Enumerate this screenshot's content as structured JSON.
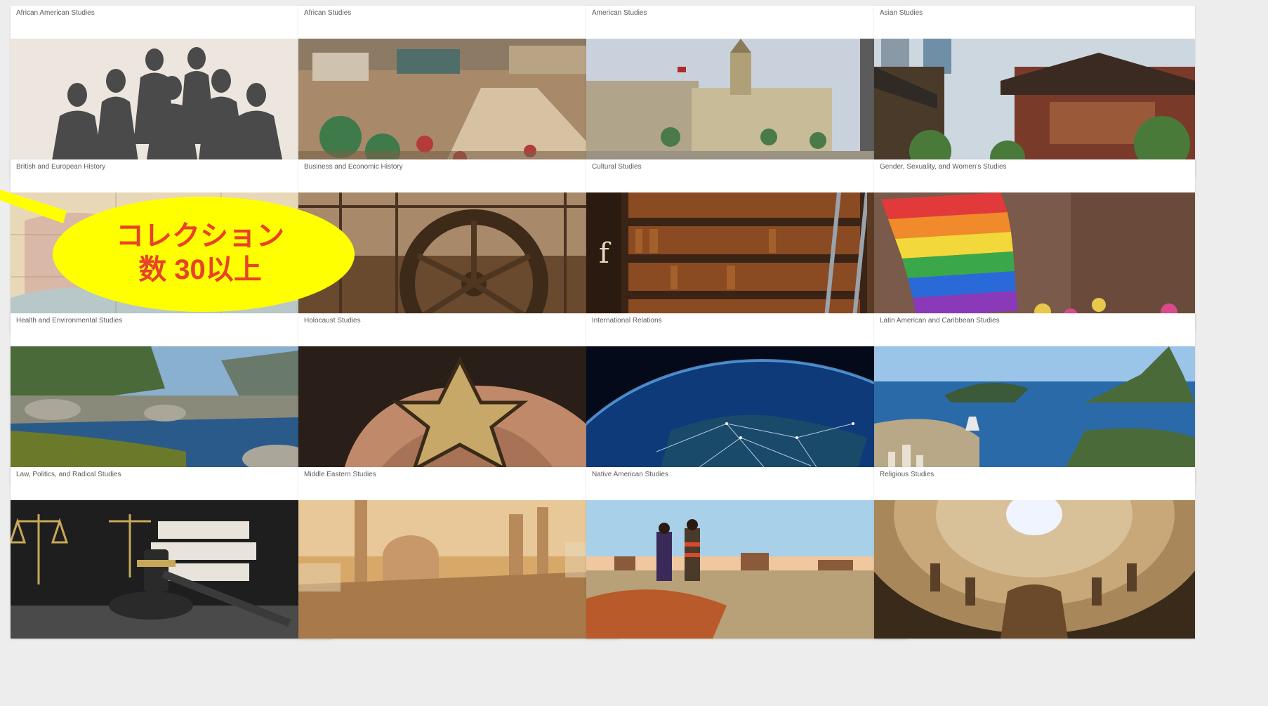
{
  "collections": [
    {
      "title": "African American Studies",
      "image": "portrait-engraving"
    },
    {
      "title": "African Studies",
      "image": "market-street"
    },
    {
      "title": "American Studies",
      "image": "historic-town-square"
    },
    {
      "title": "Asian Studies",
      "image": "chinese-temple-city"
    },
    {
      "title": "British and European History",
      "image": "antique-map"
    },
    {
      "title": "Business and Economic History",
      "image": "industrial-wheel"
    },
    {
      "title": "Cultural Studies",
      "image": "library-bookshelves"
    },
    {
      "title": "Gender, Sexuality, and Women's Studies",
      "image": "rainbow-flag"
    },
    {
      "title": "Health and Environmental Studies",
      "image": "river-landscape"
    },
    {
      "title": "Holocaust Studies",
      "image": "star-badge-hands"
    },
    {
      "title": "International Relations",
      "image": "earth-network"
    },
    {
      "title": "Latin American and Caribbean Studies",
      "image": "rio-bay"
    },
    {
      "title": "Law, Politics, and Radical Studies",
      "image": "gavel-scales"
    },
    {
      "title": "Middle Eastern Studies",
      "image": "mosque-skyline"
    },
    {
      "title": "Native American Studies",
      "image": "desert-mesa"
    },
    {
      "title": "Religious Studies",
      "image": "cathedral-dome"
    }
  ],
  "callout": {
    "line1": "コレクション",
    "line2": "数 30以上",
    "fill_color": "#ffff00",
    "text_color": "#e8422a"
  }
}
